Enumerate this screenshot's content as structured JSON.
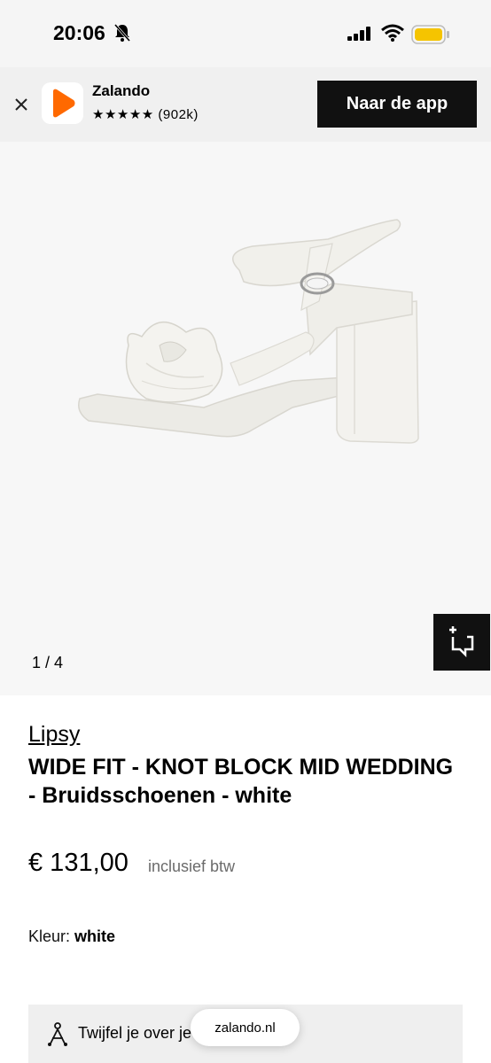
{
  "status": {
    "time": "20:06"
  },
  "banner": {
    "app_name": "Zalando",
    "rating": "★★★★★ (902k)",
    "open_app_label": "Naar de app"
  },
  "gallery": {
    "counter": "1 / 4"
  },
  "product": {
    "brand": "Lipsy",
    "title": "WIDE FIT - KNOT BLOCK MID WEDDING - Bruidsschoenen - white",
    "price": "€ 131,00",
    "vat_note": "inclusief btw",
    "color_label": "Kleur:",
    "color_value": "white"
  },
  "help": {
    "text": "Twijfel je over je maat?"
  },
  "browser": {
    "url": "zalando.nl"
  },
  "colors": {
    "brand_orange": "#ff6900",
    "button_black": "#111111",
    "battery": "#f5c400"
  }
}
